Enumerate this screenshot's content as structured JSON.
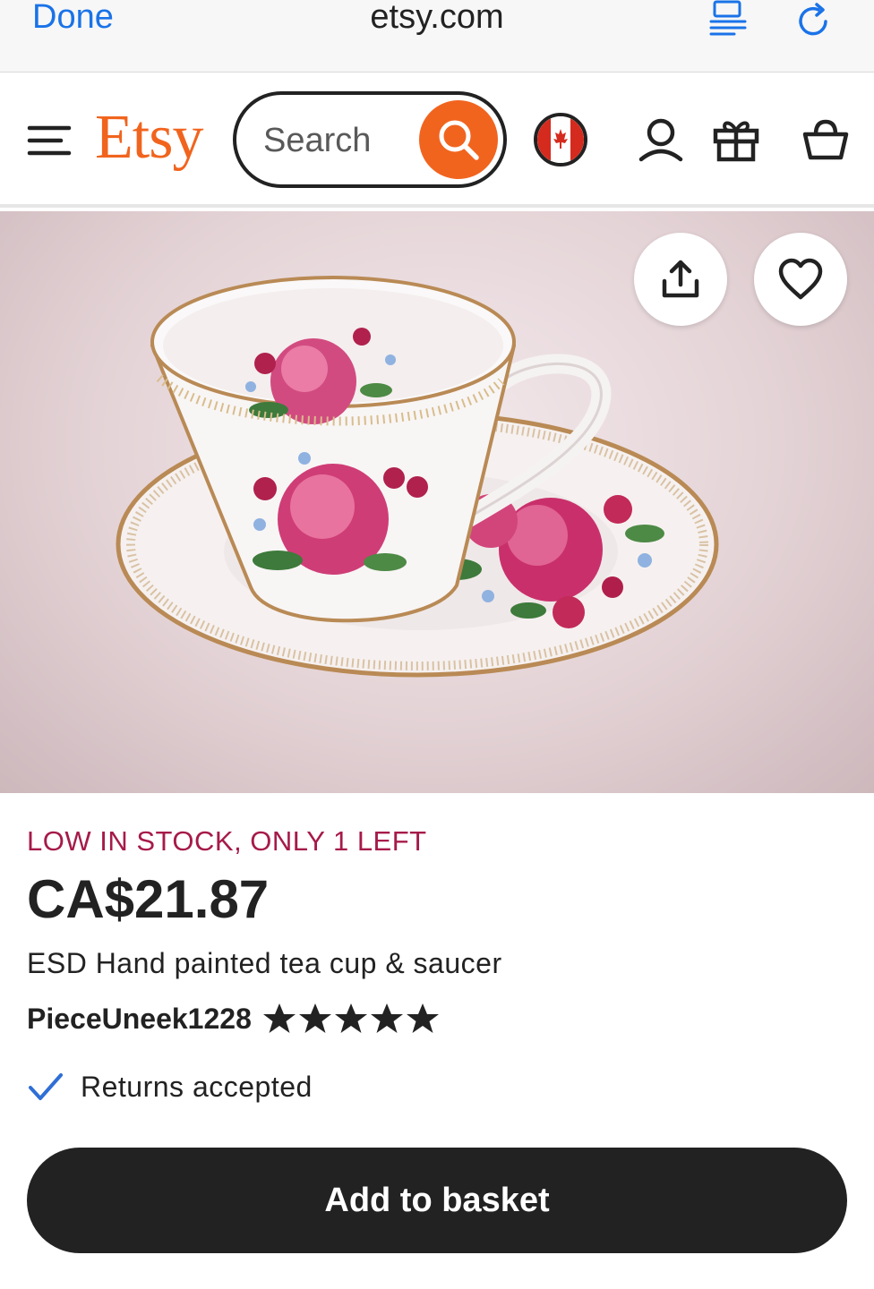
{
  "browser": {
    "done_label": "Done",
    "url": "etsy.com"
  },
  "header": {
    "logo": "Etsy",
    "search_placeholder": "Search",
    "brand_color": "#f1641e",
    "icons": [
      "menu-icon",
      "search-icon",
      "canada-flag-icon",
      "account-icon",
      "gift-icon",
      "basket-icon"
    ]
  },
  "image": {
    "alt": "Hand painted tea cup and saucer with pink roses",
    "buttons": [
      "share-icon",
      "favorite-heart-icon"
    ]
  },
  "product": {
    "stock_note": "LOW IN STOCK, ONLY 1 LEFT",
    "price": "CA$21.87",
    "title": "ESD Hand painted tea cup & saucer",
    "shop_name": "PieceUneek1228",
    "rating": 5,
    "rating_max": 5,
    "returns": "Returns accepted",
    "cta": "Add to basket"
  }
}
